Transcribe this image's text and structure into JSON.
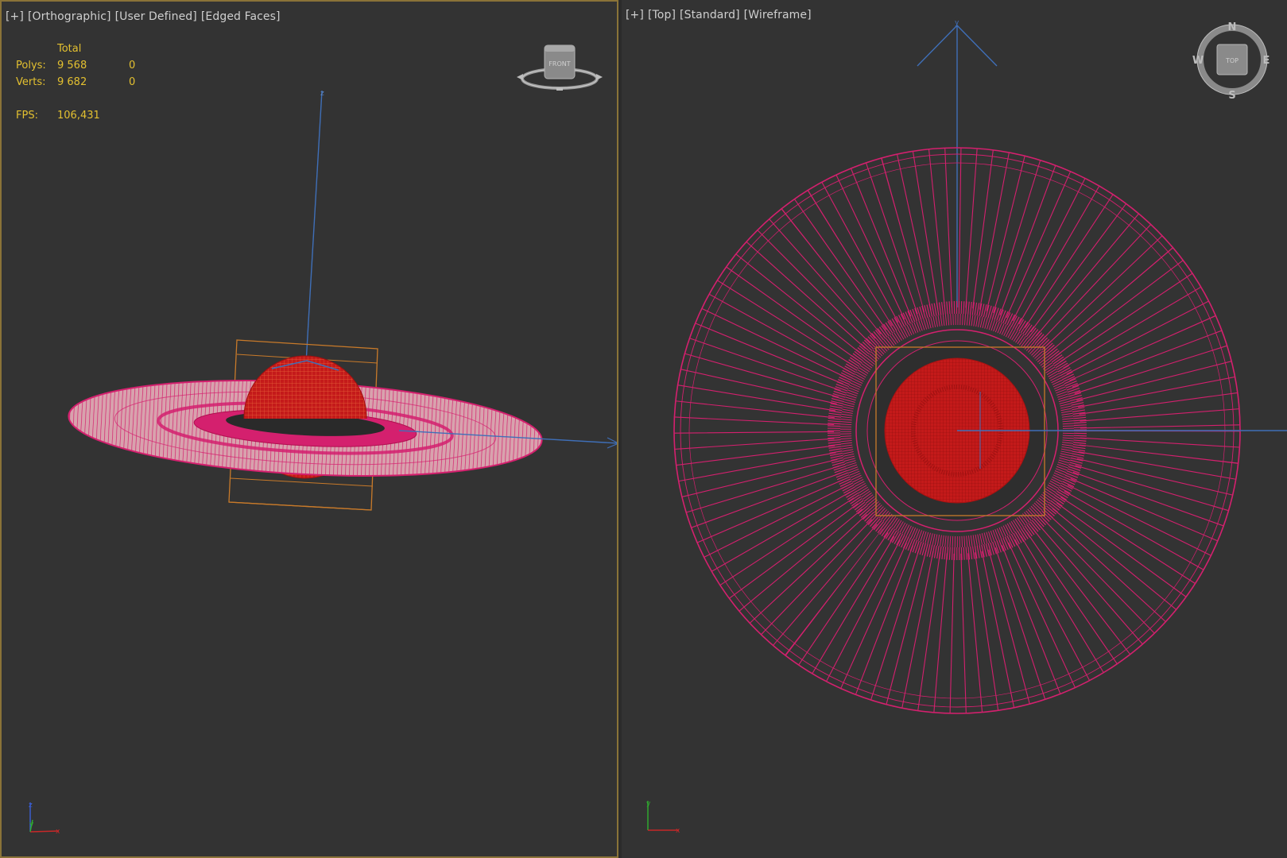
{
  "left_viewport": {
    "labels": [
      "[+]",
      "[Orthographic]",
      "[User Defined]",
      "[Edged Faces]"
    ],
    "stats": {
      "header": "Total",
      "polys_label": "Polys:",
      "polys_total": "9 568",
      "polys_selected": "0",
      "verts_label": "Verts:",
      "verts_total": "9 682",
      "verts_selected": "0",
      "fps_label": "FPS:",
      "fps_value": "106,431"
    },
    "viewcube_face": "FRONT",
    "axis_z_label": "z",
    "axis_y_label": "y",
    "axis_x_label": "x"
  },
  "right_viewport": {
    "labels": [
      "[+]",
      "[Top]",
      "[Standard]",
      "[Wireframe]"
    ],
    "compass": {
      "n": "N",
      "s": "S",
      "e": "E",
      "w": "W",
      "face": "TOP"
    },
    "axis_y_label": "y",
    "axis_x_label": "x"
  },
  "colors": {
    "viewport_bg": "#333333",
    "active_border": "#8a7338",
    "stats_text": "#e3c030",
    "wire_pink": "#d4206e",
    "sphere_red": "#c41a1a",
    "bbox_orange": "#c87a2a",
    "axis_blue": "#3f6fb8"
  }
}
